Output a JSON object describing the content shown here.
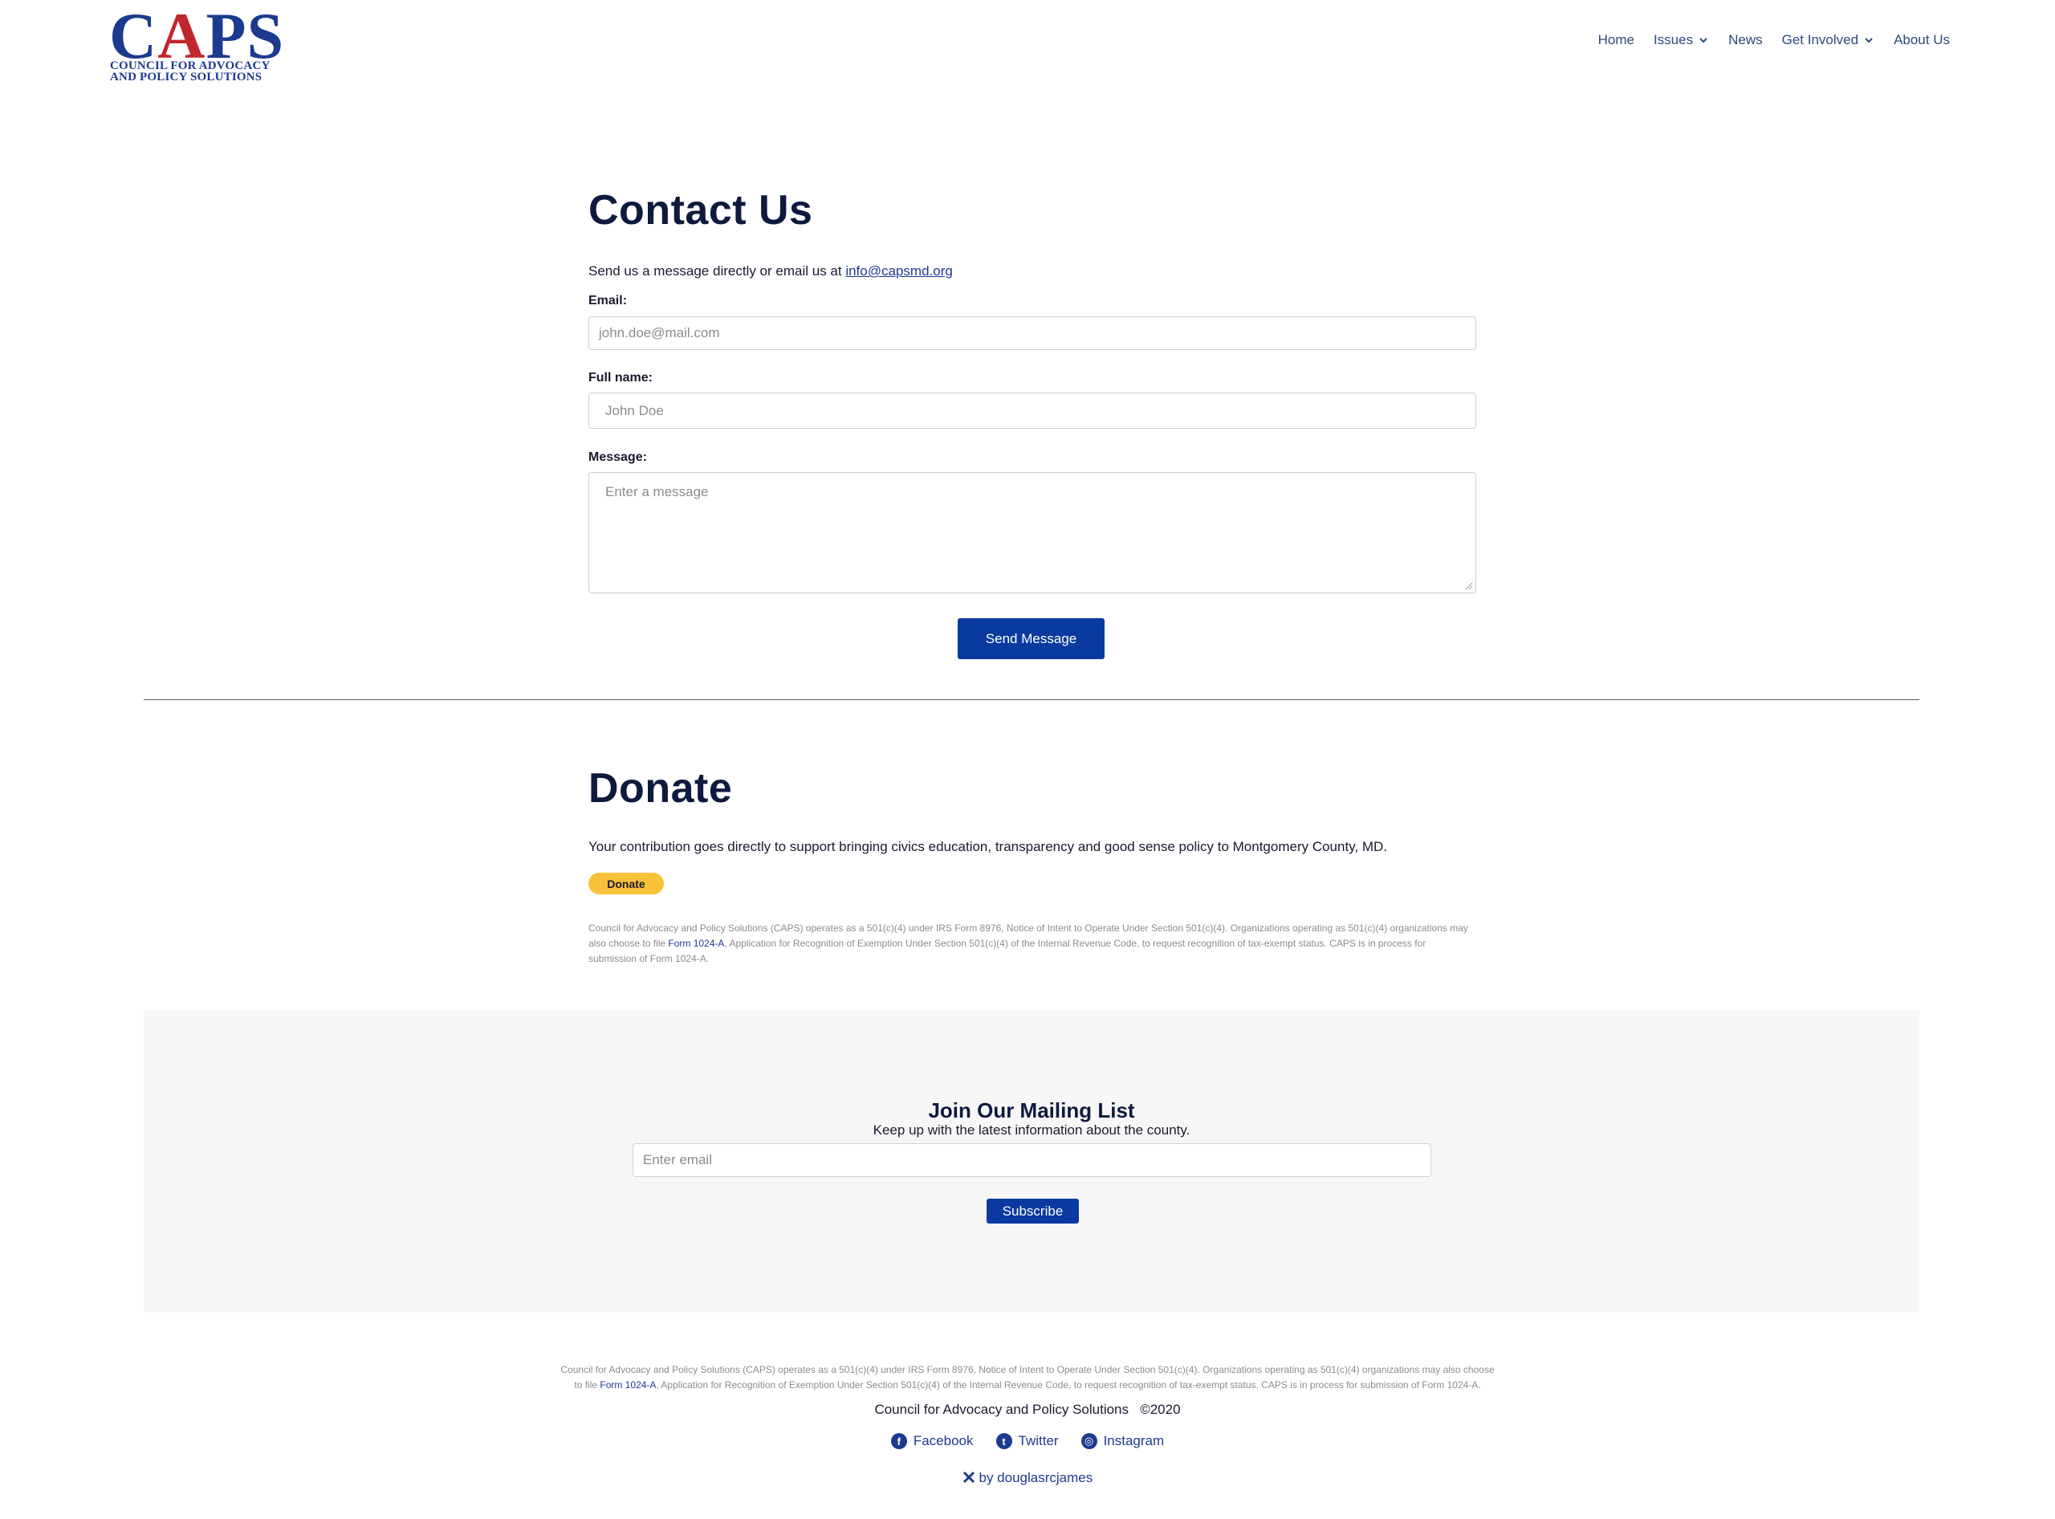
{
  "logo": {
    "word": "CAPS",
    "line1": "COUNCIL FOR ADVOCACY",
    "line2": "AND POLICY SOLUTIONS"
  },
  "nav": {
    "items": [
      {
        "label": "Home",
        "dropdown": false
      },
      {
        "label": "Issues",
        "dropdown": true
      },
      {
        "label": "News",
        "dropdown": false
      },
      {
        "label": "Get Involved",
        "dropdown": true
      },
      {
        "label": "About Us",
        "dropdown": false
      }
    ]
  },
  "contact": {
    "title": "Contact Us",
    "intro_prefix": "Send us a message directly or email us at ",
    "intro_link": "info@capsmd.org",
    "email_label": "Email:",
    "email_placeholder": "john.doe@mail.com",
    "name_label": "Full name:",
    "name_placeholder": "John Doe",
    "message_label": "Message:",
    "message_placeholder": "Enter a message",
    "send_label": "Send Message"
  },
  "donate": {
    "title": "Donate",
    "text": "Your contribution goes directly to support bringing civics education, transparency and good sense policy to Montgomery County, MD.",
    "button_label": "Donate",
    "notice_a": "Council for Advocacy and Policy Solutions (CAPS) operates as a 501(c)(4) under IRS Form 8976, Notice of Intent to Operate Under Section 501(c)(4). Organizations operating as 501(c)(4) organizations may also choose to file ",
    "notice_link": "Form 1024-A",
    "notice_b": ", Application for Recognition of Exemption Under Section 501(c)(4) of the Internal Revenue Code, to request recognition of tax-exempt status. CAPS is in process for submission of Form 1024-A."
  },
  "mailing": {
    "title": "Join Our Mailing List",
    "subtitle": "Keep up with the latest information about the county.",
    "email_placeholder": "Enter email",
    "subscribe_label": "Subscribe"
  },
  "footer": {
    "notice_a": "Council for Advocacy and Policy Solutions (CAPS) operates as a 501(c)(4) under IRS Form 8976, Notice of Intent to Operate Under Section 501(c)(4). Organizations operating as 501(c)(4) organizations may also choose",
    "notice_b": "to file ",
    "notice_link": "Form 1024-A",
    "notice_c": ", Application for Recognition of Exemption Under Section 501(c)(4) of the Internal Revenue Code, to request recognition of tax-exempt status. CAPS is in process for submission of Form 1024-A.",
    "org": "Council for Advocacy and Policy Solutions",
    "copyright": "©2020",
    "social": [
      {
        "label": "Facebook",
        "icon": "facebook-icon",
        "glyph": "f"
      },
      {
        "label": "Twitter",
        "icon": "twitter-icon",
        "glyph": "t"
      },
      {
        "label": "Instagram",
        "icon": "instagram-icon",
        "glyph": "◎"
      }
    ],
    "credit": "by douglasrcjames"
  },
  "colors": {
    "brand_blue": "#1d3a8f",
    "button_blue": "#0a3aa0",
    "logo_red": "#c0262d",
    "paypal_yellow": "#f7c13a"
  }
}
